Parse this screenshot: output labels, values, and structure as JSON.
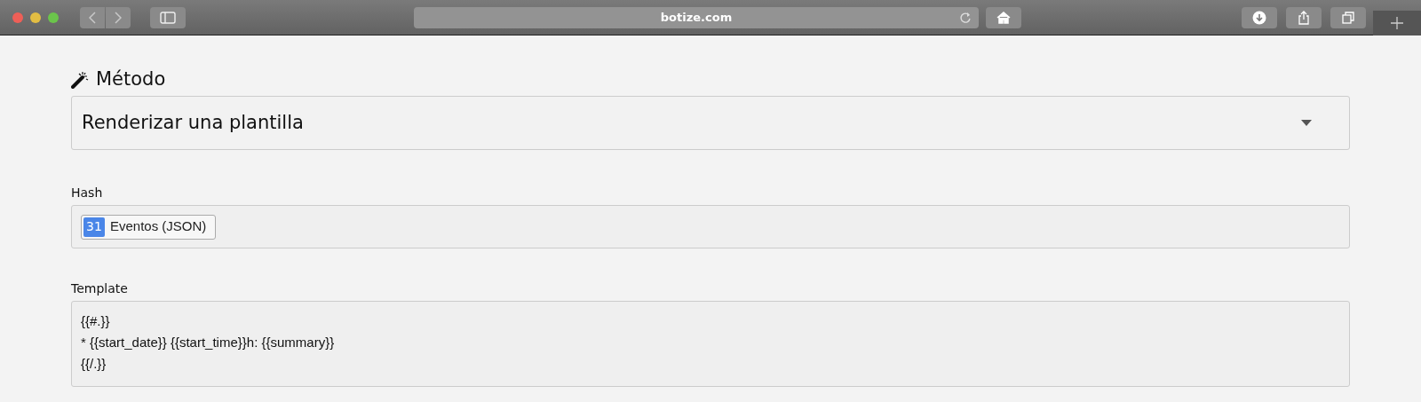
{
  "browser": {
    "url": "botize.com"
  },
  "method": {
    "label": "Método",
    "value": "Renderizar una plantilla"
  },
  "hash": {
    "label": "Hash",
    "tag": "Eventos (JSON)",
    "tag_icon_text": "31"
  },
  "template": {
    "label": "Template",
    "value": "{{#.}}\n* {{start_date}} {{start_time}}h: {{summary}}\n{{/.}}"
  }
}
